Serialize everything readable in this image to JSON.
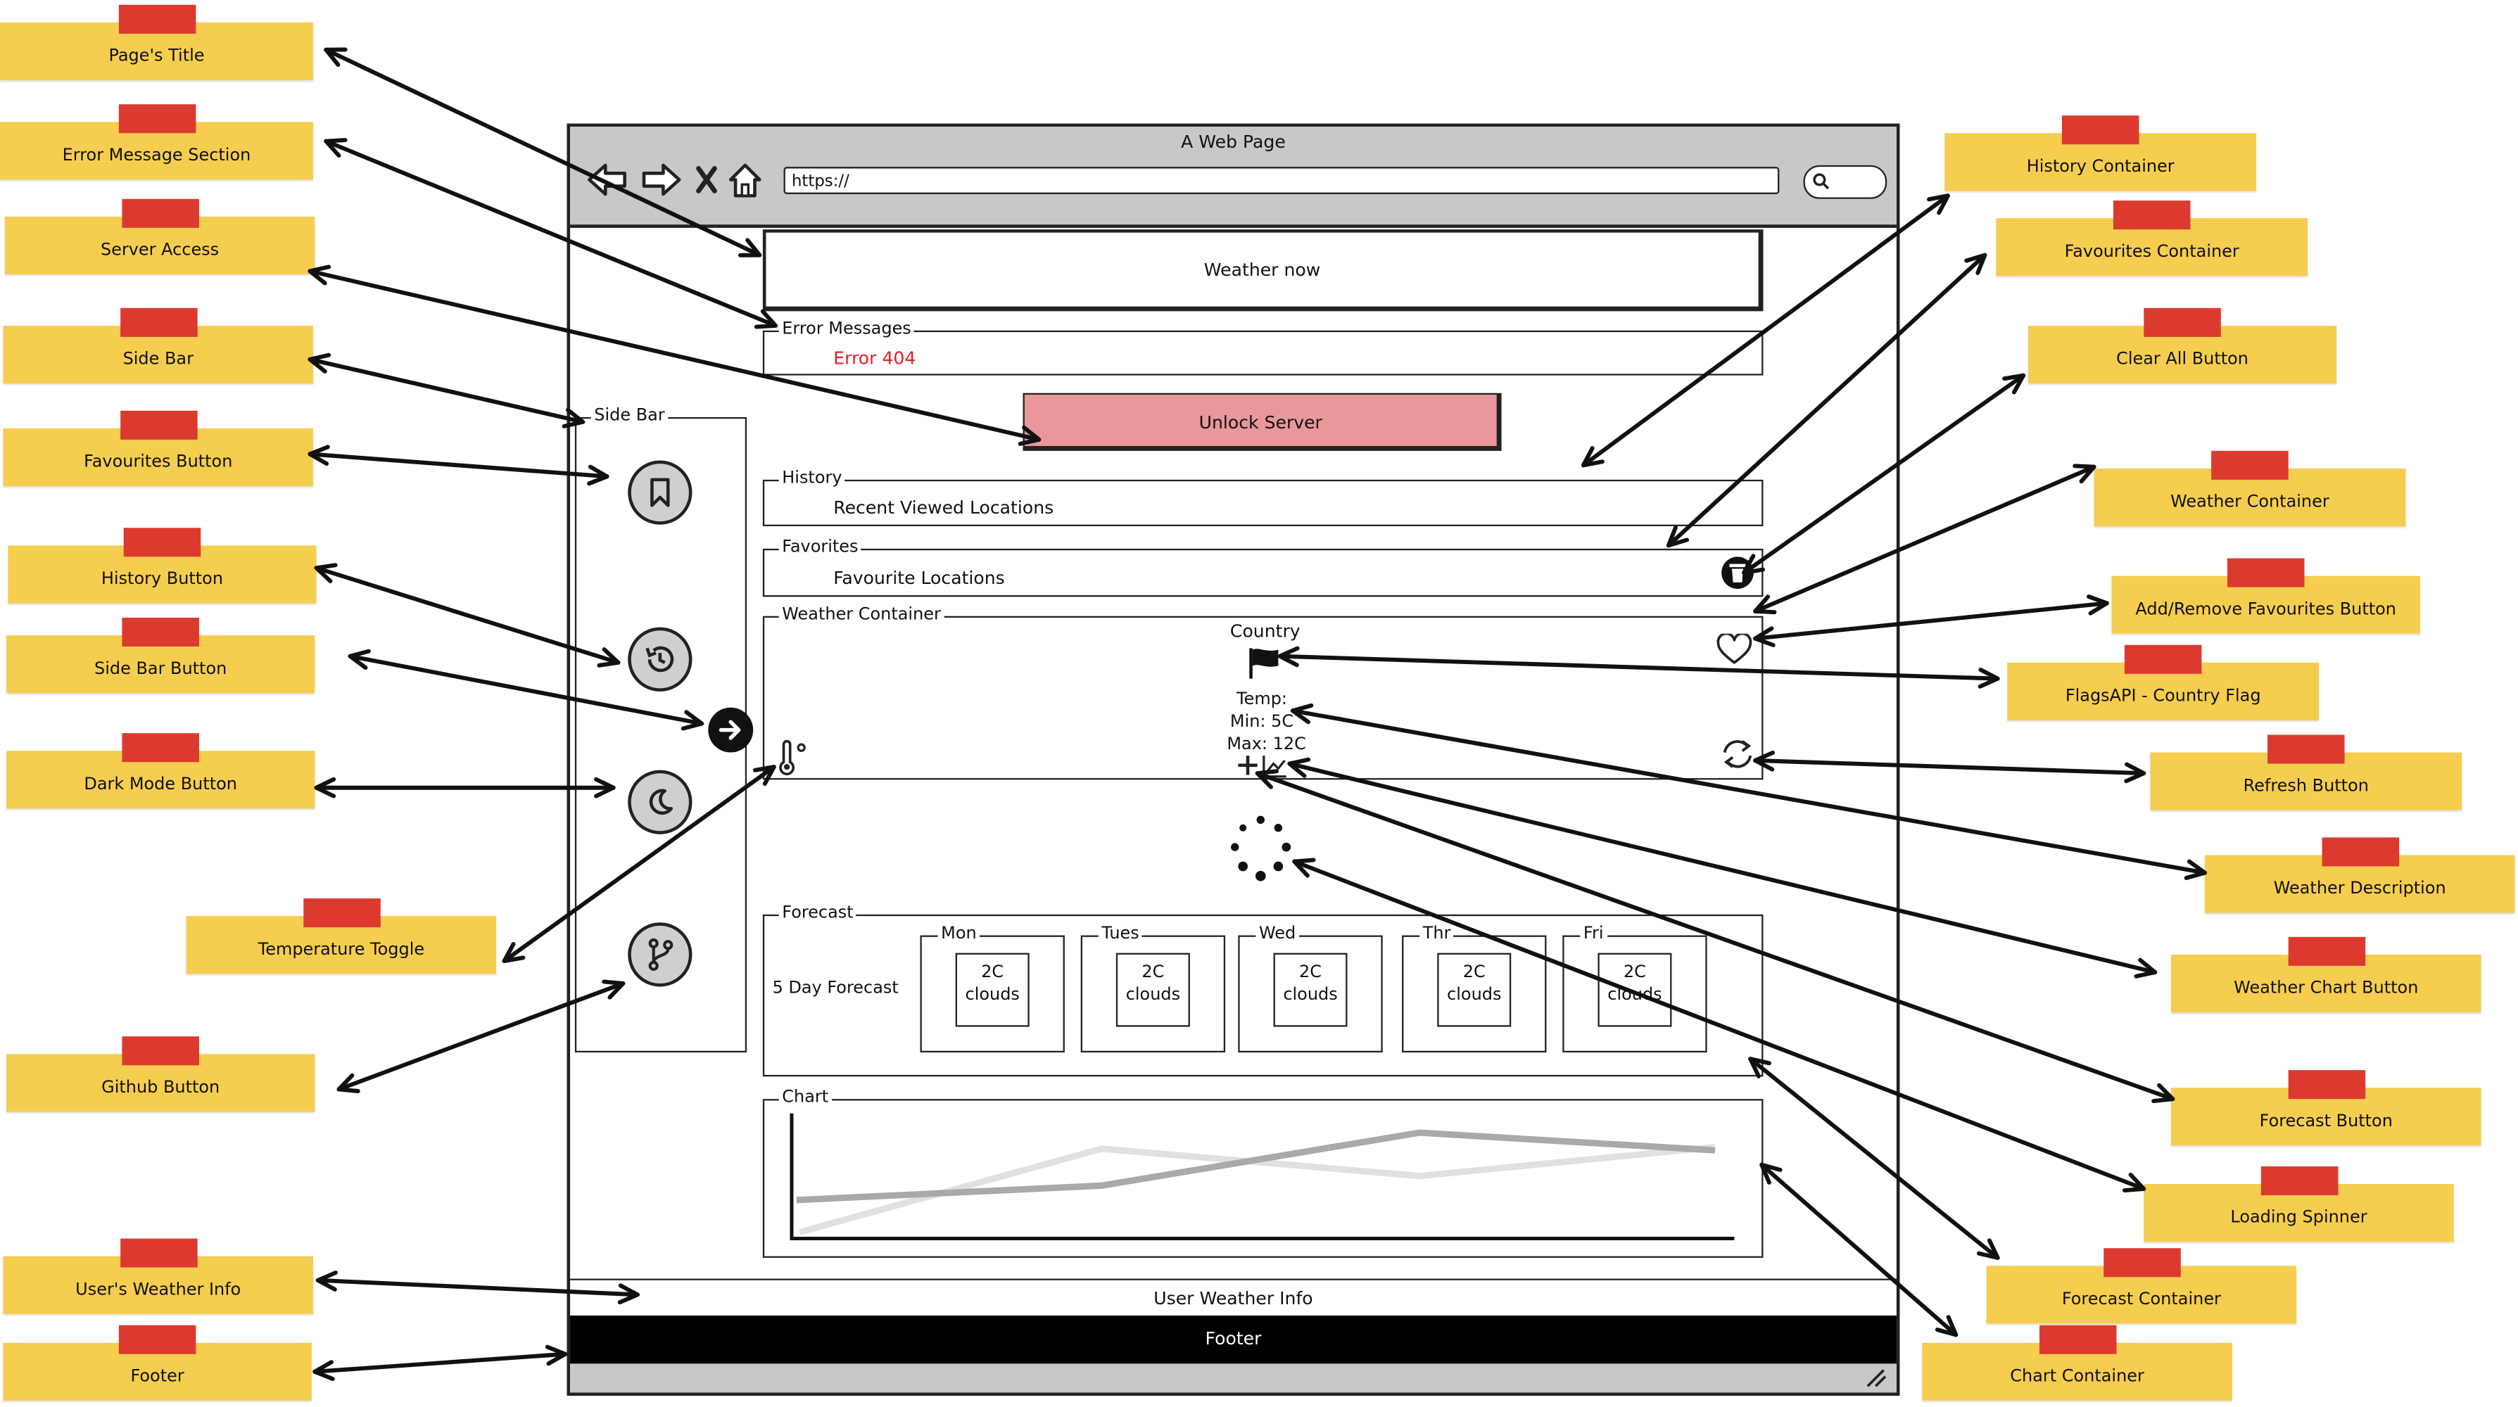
{
  "browser": {
    "window_title": "A Web Page",
    "url": "https://",
    "page_title_text": "Weather now",
    "error_section_label": "Error Messages",
    "error_text": "Error 404",
    "unlock_button_label": "Unlock Server",
    "sidebar_label": "Side Bar",
    "history": {
      "label": "History",
      "text": "Recent Viewed Locations"
    },
    "favorites": {
      "label": "Favorites",
      "text": "Favourite Locations"
    },
    "weather": {
      "label": "Weather Container",
      "country": "Country",
      "temp": "Temp:",
      "min": "Min: 5C",
      "max": "Max: 12C"
    },
    "forecast": {
      "label": "Forecast",
      "title": "5 Day Forecast",
      "days": [
        {
          "day": "Mon",
          "temp": "2C",
          "desc": "clouds"
        },
        {
          "day": "Tues",
          "temp": "2C",
          "desc": "clouds"
        },
        {
          "day": "Wed",
          "temp": "2C",
          "desc": "clouds"
        },
        {
          "day": "Thr",
          "temp": "2C",
          "desc": "clouds"
        },
        {
          "day": "Fri",
          "temp": "2C",
          "desc": "clouds"
        }
      ]
    },
    "chart_label": "Chart",
    "user_weather_info": "User Weather Info",
    "footer": "Footer"
  },
  "annotations": {
    "left": [
      "Page's Title",
      "Error Message Section",
      "Server Access",
      "Side Bar",
      "Favourites Button",
      "History Button",
      "Side Bar Button",
      "Dark Mode Button",
      "Temperature Toggle",
      "Github Button",
      "User's Weather Info",
      "Footer"
    ],
    "right": [
      "History Container",
      "Favourites Container",
      "Clear All Button",
      "Weather Container",
      "Add/Remove Favourites Button",
      "FlagsAPI - Country Flag",
      "Refresh Button",
      "Weather Description",
      "Weather Chart Button",
      "Forecast Button",
      "Loading Spinner",
      "Forecast Container",
      "Chart Container"
    ]
  },
  "colors": {
    "note_yellow": "#f5cd4f",
    "tape_red": "#dc3a2f",
    "unlock_button": "#e9979a",
    "error_text": "#e0202a",
    "chrome_gray": "#c8c8c8",
    "footer_black": "#000000"
  },
  "icons": [
    "back-arrow-icon",
    "forward-arrow-icon",
    "close-icon",
    "home-icon",
    "search-icon",
    "bookmark-icon",
    "history-icon",
    "sidebar-arrow-icon",
    "moon-icon",
    "git-branch-icon",
    "thermometer-icon",
    "trash-icon",
    "heart-icon",
    "flag-icon",
    "refresh-icon",
    "plus-icon",
    "chart-icon",
    "spinner-icon",
    "resize-grip-icon"
  ]
}
